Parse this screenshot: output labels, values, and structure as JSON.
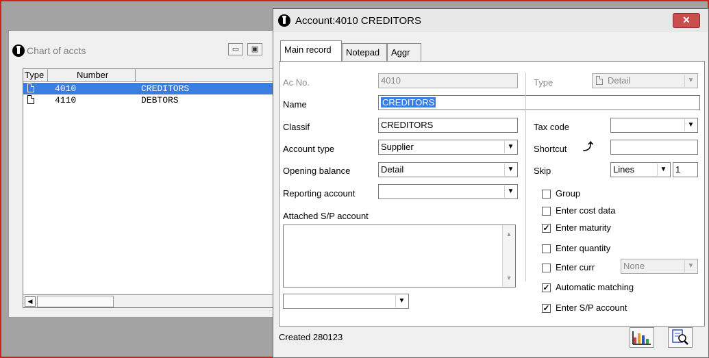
{
  "coa_window": {
    "title": "Chart of accts",
    "columns": [
      "Type",
      "Number",
      ""
    ],
    "rows": [
      {
        "number": "4010",
        "name": "CREDITORS",
        "selected": true
      },
      {
        "number": "4110",
        "name": "DEBTORS",
        "selected": false
      }
    ]
  },
  "dialog": {
    "title": "Account:4010 CREDITORS",
    "close_label": "✕",
    "tabs": [
      {
        "label": "Main record",
        "active": true
      },
      {
        "label": "Notepad",
        "active": false
      },
      {
        "label": "Aggr",
        "active": false
      }
    ],
    "fields": {
      "ac_no": {
        "label": "Ac No.",
        "value": "4010"
      },
      "type": {
        "label": "Type",
        "value": "Detail"
      },
      "name": {
        "label": "Name",
        "value": "CREDITORS"
      },
      "classif": {
        "label": "Classif",
        "value": "CREDITORS"
      },
      "account_type": {
        "label": "Account type",
        "value": "Supplier"
      },
      "opening_balance": {
        "label": "Opening balance",
        "value": "Detail"
      },
      "reporting_account": {
        "label": "Reporting account",
        "value": ""
      },
      "attached_sp": {
        "label": "Attached S/P account"
      },
      "tax_code": {
        "label": "Tax code",
        "value": ""
      },
      "shortcut": {
        "label": "Shortcut",
        "value": ""
      },
      "skip": {
        "label": "Skip",
        "unit": "Lines",
        "value": "1"
      }
    },
    "checkboxes": [
      {
        "label": "Group",
        "checked": false
      },
      {
        "label": "Enter cost data",
        "checked": false
      },
      {
        "label": "Enter maturity",
        "checked": true
      },
      {
        "label": "Enter quantity",
        "checked": false
      },
      {
        "label": "Enter curr",
        "checked": false
      },
      {
        "label": "Automatic matching",
        "checked": true
      },
      {
        "label": "Enter S/P account",
        "checked": true
      }
    ],
    "currency": "None",
    "status": "Created 280123"
  }
}
